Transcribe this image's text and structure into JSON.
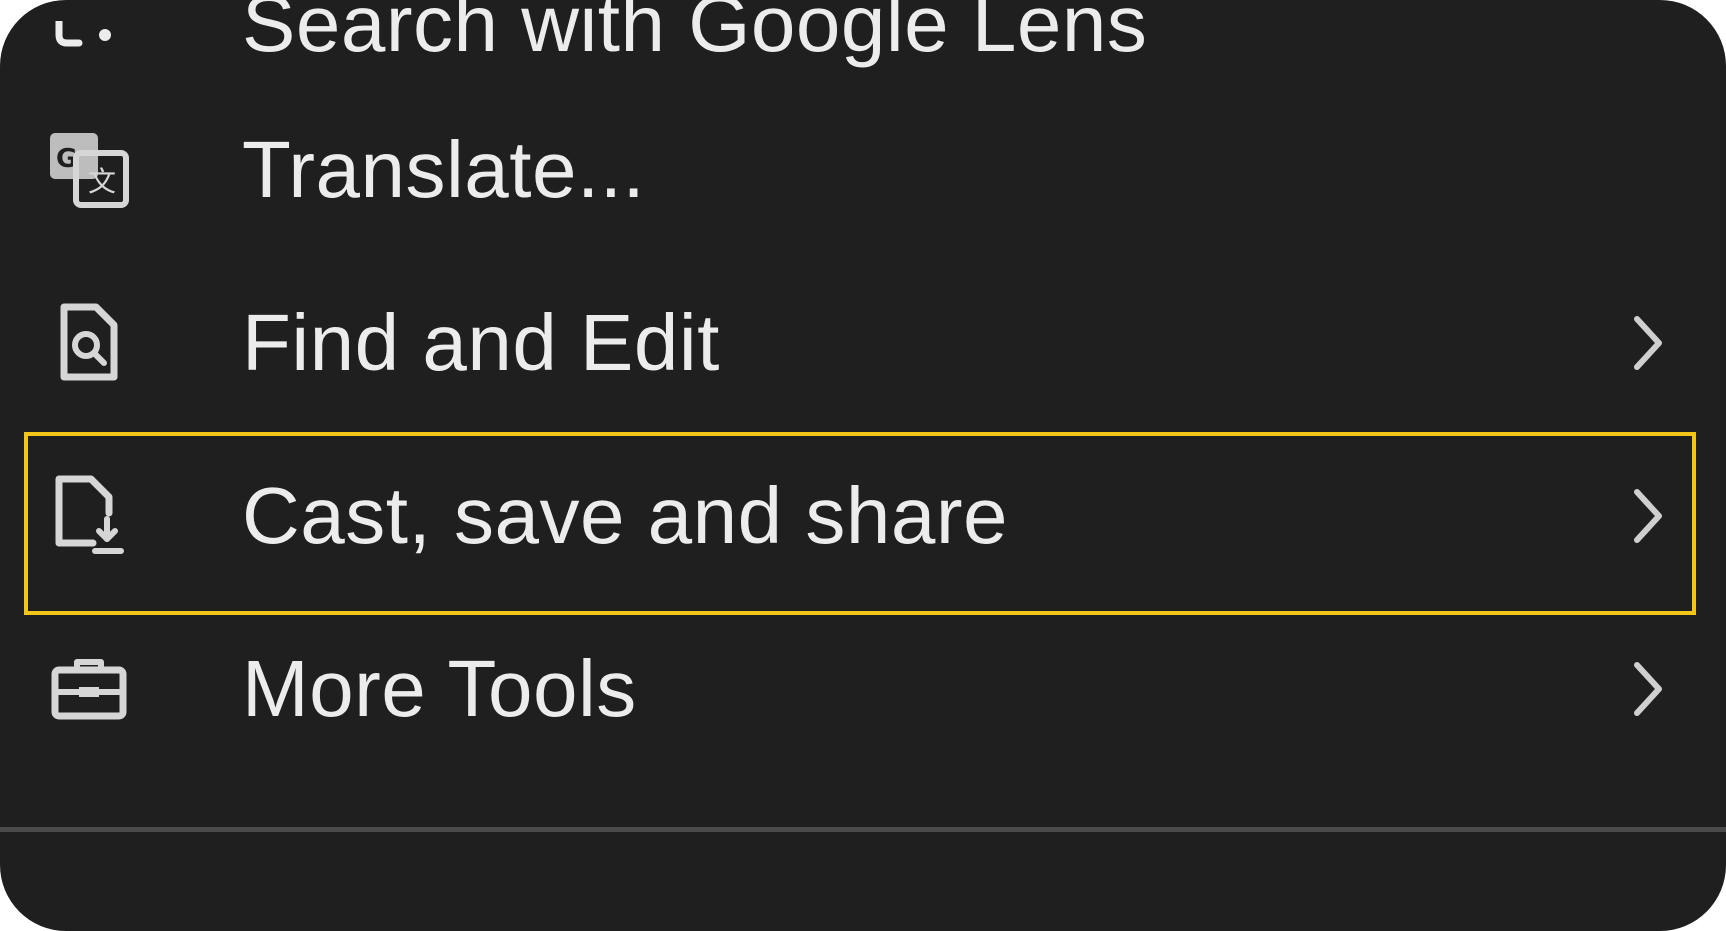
{
  "colors": {
    "menu_background": "#1f1f1f",
    "text": "#ececec",
    "highlight_border": "#f3c519",
    "divider": "#4a4a4a"
  },
  "menu": {
    "items": [
      {
        "label": "Search with Google Lens",
        "icon": "google-lens-icon",
        "has_submenu": false
      },
      {
        "label": "Translate...",
        "icon": "translate-icon",
        "has_submenu": false
      },
      {
        "label": "Find and Edit",
        "icon": "find-in-page-icon",
        "has_submenu": true
      },
      {
        "label": "Cast, save and share",
        "icon": "save-file-icon",
        "has_submenu": true,
        "highlighted": true
      },
      {
        "label": "More Tools",
        "icon": "toolbox-icon",
        "has_submenu": true
      }
    ]
  }
}
